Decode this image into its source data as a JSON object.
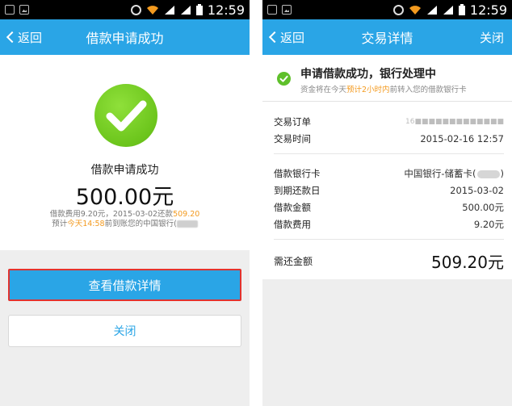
{
  "left": {
    "status": {
      "time": "12:59"
    },
    "header": {
      "back_label": "返回",
      "title": "借款申请成功"
    },
    "success": {
      "title": "借款申请成功",
      "amount": "500.00元",
      "fee_prefix": "借款费用9.20元，2015-03-02还款",
      "fee_total": "509.20",
      "eta_prefix": "预计",
      "eta_time": "今天14:58",
      "eta_suffix": "前到账您的中国银行("
    },
    "buttons": {
      "details": "查看借款详情",
      "close": "关闭"
    }
  },
  "right": {
    "status": {
      "time": "12:59"
    },
    "header": {
      "back_label": "返回",
      "title": "交易详情",
      "close_label": "关闭"
    },
    "notice": {
      "title": "申请借款成功，银行处理中",
      "sub_prefix": "资金将在今天",
      "sub_highlight": "预计2小时内",
      "sub_suffix": "前转入您的借款银行卡"
    },
    "details": {
      "order_label": "交易订单",
      "order_value": "16■■■■■■■■■■■■■",
      "time_label": "交易时间",
      "time_value": "2015-02-16 12:57",
      "bank_label": "借款银行卡",
      "bank_value": "中国银行-储蓄卡(",
      "due_label": "到期还款日",
      "due_value": "2015-03-02",
      "amount_label": "借款金额",
      "amount_value": "500.00元",
      "fee_label": "借款费用",
      "fee_value": "9.20元",
      "total_label": "需还金额",
      "total_value": "509.20元"
    }
  },
  "colors": {
    "accent": "#2aa5e6",
    "success": "#6cc51c",
    "highlight": "#f39a1f",
    "focus_border": "#e2332e"
  }
}
